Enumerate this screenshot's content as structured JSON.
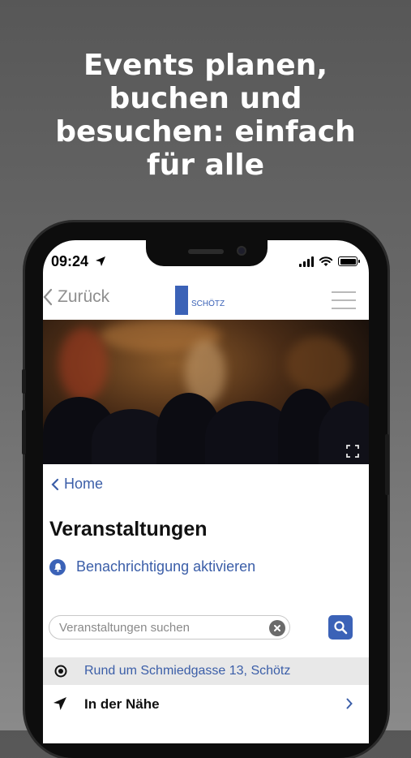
{
  "headline": {
    "lines": [
      "Events planen,",
      "buchen und",
      "besuchen: einfach",
      "für alle"
    ]
  },
  "status_bar": {
    "time": "09:24"
  },
  "nav": {
    "back_label": "Zurück",
    "logo_text": "SCHÖTZ"
  },
  "content": {
    "home_link": "Home",
    "page_title": "Veranstaltungen",
    "notify_label": "Benachrichtigung aktivieren",
    "search_placeholder": "Veranstaltungen suchen",
    "location_text": "Rund um Schmiedgasse 13, Schötz",
    "nearby_label": "In der Nähe"
  },
  "colors": {
    "accent": "#3b62b7",
    "link": "#3b5ea8",
    "background_top": "#575757",
    "background_bottom": "#8a8a8a"
  },
  "icons": [
    "location-arrow-icon",
    "signal-icon",
    "wifi-icon",
    "battery-icon",
    "chevron-left-icon",
    "hamburger-menu-icon",
    "expand-icon",
    "bell-icon",
    "clear-icon",
    "search-icon",
    "target-icon",
    "navigation-arrow-icon",
    "chevron-right-icon"
  ]
}
